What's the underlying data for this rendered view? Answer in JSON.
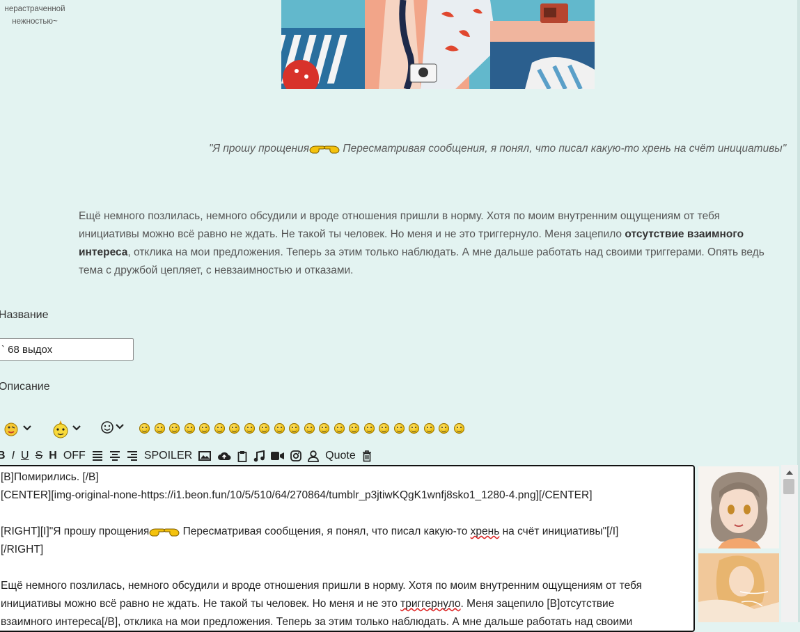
{
  "sidebar": {
    "caption_line1": "нерастраченной",
    "caption_line2": "нежностью~"
  },
  "post": {
    "image_alt": "tumblr_p3jtiwKQgK1wnfj8sko1_1280-4.png",
    "quote_part1": "\"Я прошу прощения",
    "quote_part2": " Пересматривая сообщения, я понял, что писал какую-то хрень на счёт инициативы\"",
    "paragraph_part1": "Ещё немного позлилась, немного обсудили и вроде отношения пришли в норму. Хотя по моим внутренним ощущениям от тебя инициативы можно всё равно не ждать. Не такой ты человек. Но меня и не это триггернуло. Меня зацепило ",
    "paragraph_bold": "отсутствие взаимного интереса",
    "paragraph_part2": ", отклика на мои предложения. Теперь за этим только наблюдать. А мне дальше работать над своими триггерами. Опять ведь тема с дружбой цепляет, с невзаимностью и отказами."
  },
  "form": {
    "title_label": "Название",
    "title_value": "` 68 выдох",
    "description_label": "Описание"
  },
  "toolbar": {
    "bold": "B",
    "italic": "I",
    "underline": "U",
    "strike": "S",
    "heading": "H",
    "off": "OFF",
    "spoiler": "SPOILER",
    "quote": "Quote"
  },
  "editor": {
    "line1": "[B]Помирились. [/B]",
    "line2": "[CENTER][img-original-none-https://i1.beon.fun/10/5/510/64/270864/tumblr_p3jtiwKQgK1wnfj8sko1_1280-4.png][/CENTER]",
    "line4a": "[RIGHT][I]\"Я прошу прощения",
    "line4b": " Пересматривая сообщения, я понял, что писал какую-то ",
    "line4c": "хрень",
    "line4d": " на счёт инициативы\"[/I]",
    "line5": "[/RIGHT]",
    "line7a": "Ещё немного позлилась, немного обсудили и вроде отношения пришли в норму. Хотя по моим внутренним ощущениям от тебя",
    "line8a": "инициативы можно всё равно не ждать. Не такой ты человек. Но меня и не это ",
    "line8b": "триггернуло",
    "line8c": ". Меня зацепило [B]отсутствие",
    "line9": "взаимного интереса[/B], отклика на мои предложения. Теперь за этим только наблюдать. А мне дальше работать над своими"
  },
  "emoji_count": 22,
  "colors": {
    "page_bg": "#e3f3f1",
    "text_muted": "#555555",
    "editor_border": "#111111",
    "spellcheck": "#dd2222"
  }
}
